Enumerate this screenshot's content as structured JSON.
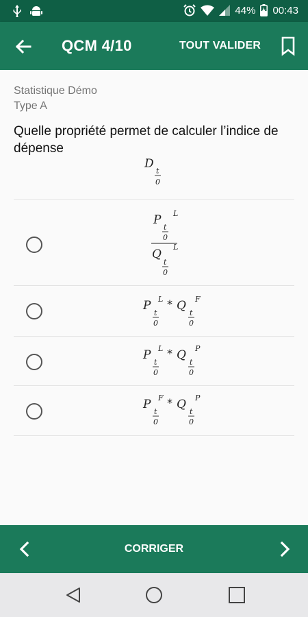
{
  "status_bar": {
    "battery_percent": "44%",
    "time": "00:43",
    "icons": [
      "usb-icon",
      "android-debug-icon",
      "alarm-icon",
      "wifi-icon",
      "signal-icon",
      "battery-charging-icon"
    ]
  },
  "app_bar": {
    "back_icon": "arrow-left-icon",
    "title": "QCM 4/10",
    "validate_all_label": "TOUT VALIDER",
    "bookmark_icon": "bookmark-icon"
  },
  "question": {
    "subject": "Statistique Démo",
    "type": "Type A",
    "text": "Quelle propriété permet de calculer l’indice de dépense",
    "formula": {
      "main": "D",
      "sub_top": "t",
      "sub_bottom": "0"
    }
  },
  "options": [
    {
      "kind": "fraction",
      "num": {
        "sym": "P",
        "sup": "L"
      },
      "den": {
        "sym": "Q",
        "sup": "L"
      },
      "sub_top": "t",
      "sub_bottom": "0"
    },
    {
      "kind": "product",
      "a": {
        "sym": "P",
        "sup": "L"
      },
      "op": "*",
      "b": {
        "sym": "Q",
        "sup": "F"
      },
      "sub_top": "t",
      "sub_bottom": "0"
    },
    {
      "kind": "product",
      "a": {
        "sym": "P",
        "sup": "L"
      },
      "op": "*",
      "b": {
        "sym": "Q",
        "sup": "P"
      },
      "sub_top": "t",
      "sub_bottom": "0"
    },
    {
      "kind": "product",
      "a": {
        "sym": "P",
        "sup": "F"
      },
      "op": "*",
      "b": {
        "sym": "Q",
        "sup": "P"
      },
      "sub_top": "t",
      "sub_bottom": "0"
    }
  ],
  "bottom_bar": {
    "prev_icon": "chevron-left-icon",
    "correct_label": "CORRIGER",
    "next_icon": "chevron-right-icon"
  },
  "nav_bar": {
    "icons": [
      "nav-back-icon",
      "nav-home-icon",
      "nav-recent-icon"
    ]
  },
  "colors": {
    "primary": "#1b7a5a",
    "status_bar": "#0f5f45",
    "background": "#fafafa"
  }
}
